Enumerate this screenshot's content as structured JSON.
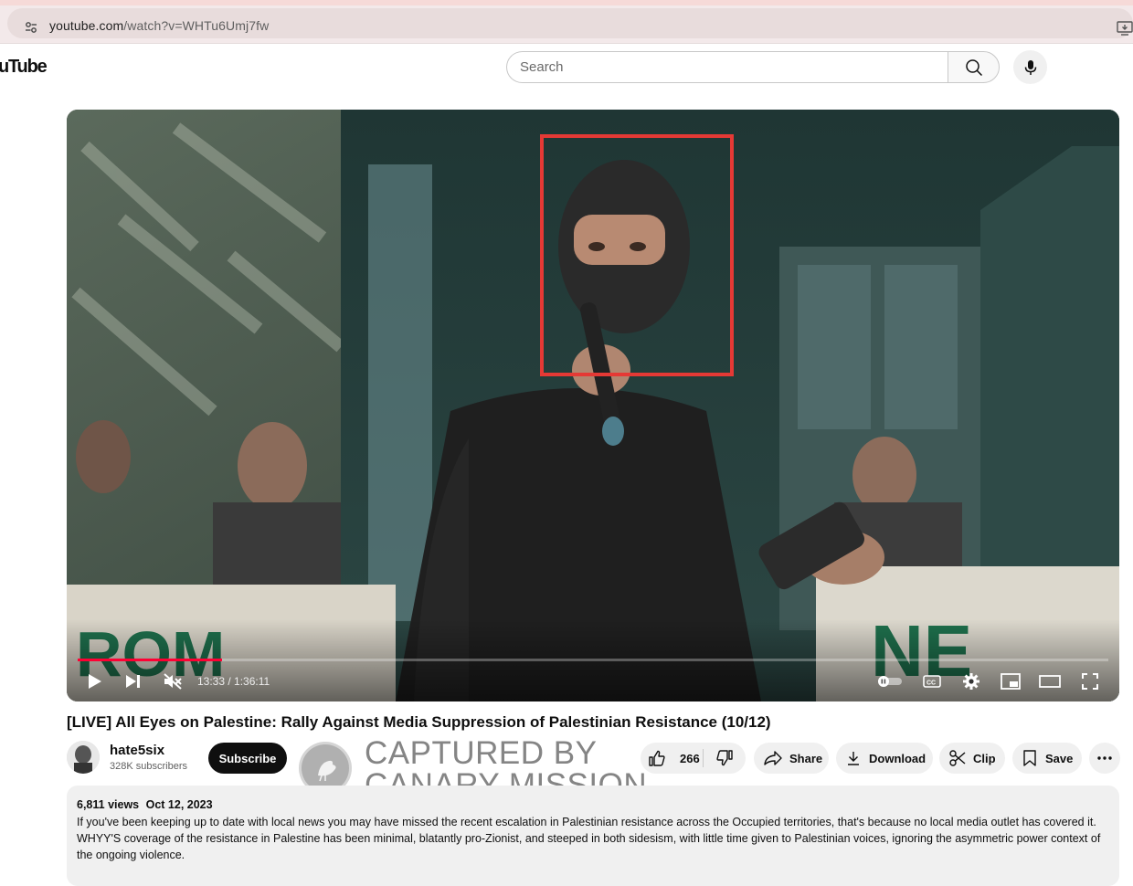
{
  "browser": {
    "url_host": "youtube.com",
    "url_path": "/watch?v=WHTu6Umj7fw"
  },
  "masthead": {
    "logo_text": "uTube",
    "search_placeholder": "Search"
  },
  "player": {
    "progress_fraction": 0.1403,
    "time_current": "13:33",
    "time_total": "1:36:11",
    "time_display": "13:33 / 1:36:11",
    "colors": {
      "progress": "#ff0033",
      "highlight": "#e53935"
    }
  },
  "video": {
    "title": "[LIVE] All Eyes on Palestine: Rally Against Media Suppression of Palestinian Resistance (10/12)"
  },
  "channel": {
    "name": "hate5six",
    "subscribers": "328K subscribers",
    "subscribe_label": "Subscribe"
  },
  "watermark": {
    "line1": "CAPTURED BY",
    "line2": "CANARY MISSION"
  },
  "actions": {
    "like_count": "266",
    "share_label": "Share",
    "download_label": "Download",
    "clip_label": "Clip",
    "save_label": "Save"
  },
  "description": {
    "views": "6,811 views",
    "date": "Oct 12, 2023",
    "text": "If you've been keeping up to date with local news you may have missed the recent escalation in Palestinian resistance across the Occupied territories, that's because no local media outlet has covered it. WHYY'S coverage of the resistance in Palestine has been minimal, blatantly pro-Zionist, and steeped in both sidesism, with little time given to Palestinian voices, ignoring the asymmetric power context of the ongoing violence."
  }
}
